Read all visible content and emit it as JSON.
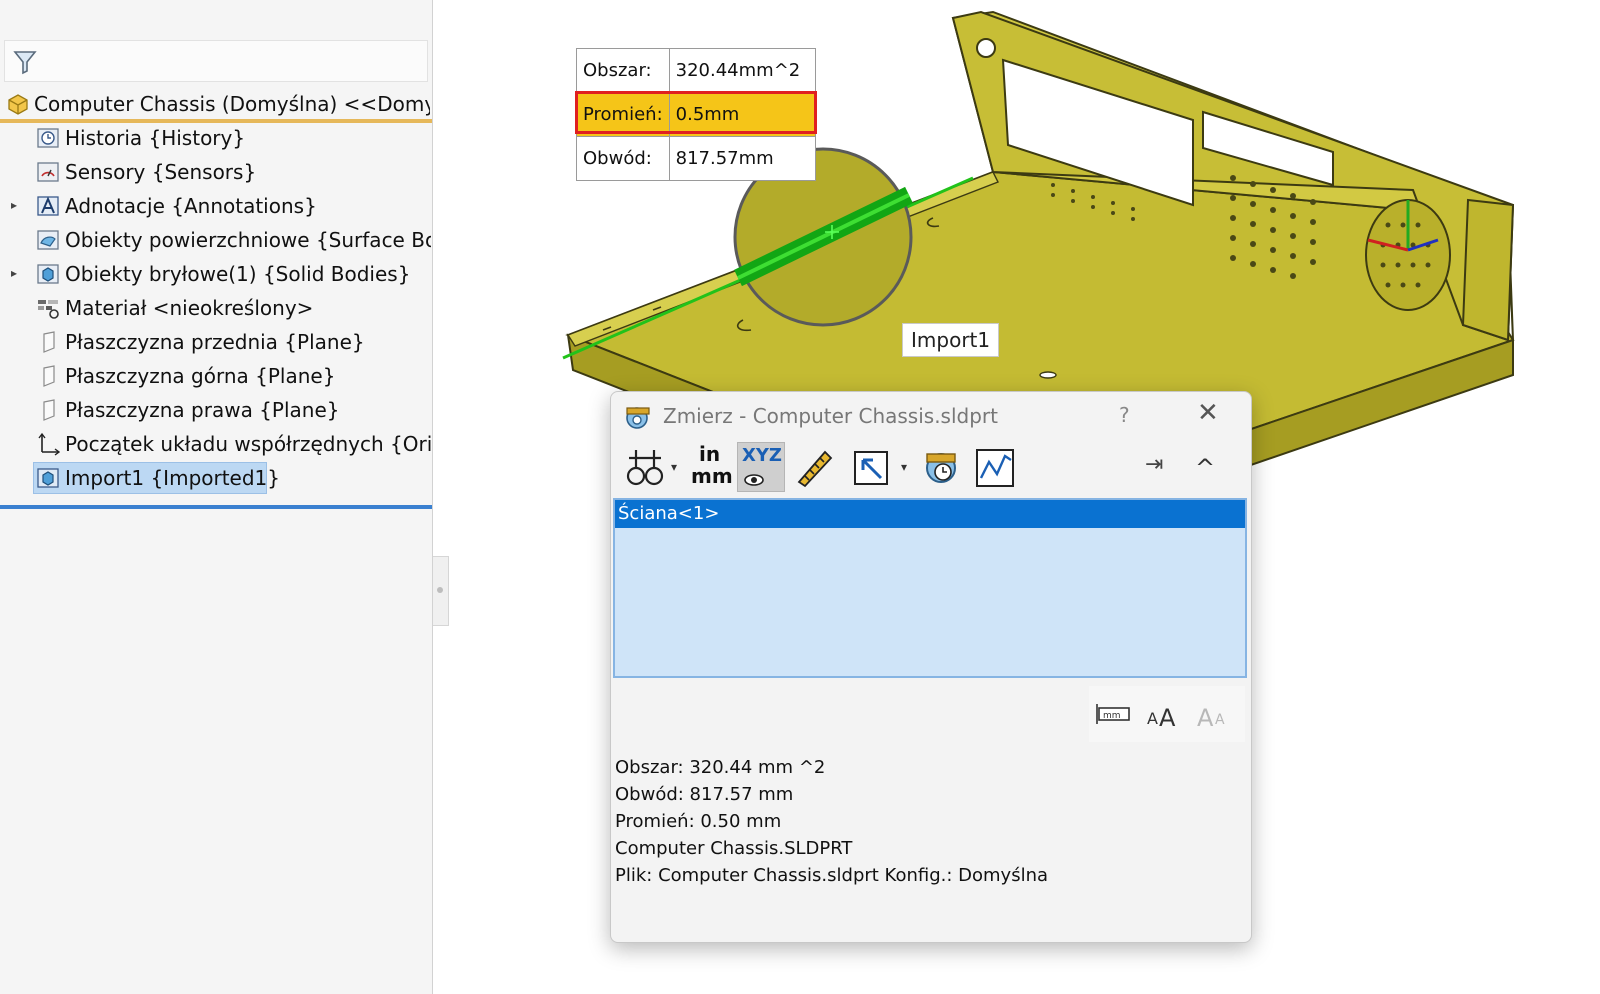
{
  "tree": {
    "root_label": "Computer Chassis (Domyślna) <<Domyśl",
    "items": [
      {
        "label": "Historia {History}",
        "icon": "history-icon",
        "expandable": false
      },
      {
        "label": "Sensory {Sensors}",
        "icon": "sensor-icon",
        "expandable": false
      },
      {
        "label": "Adnotacje {Annotations}",
        "icon": "annotation-icon",
        "expandable": true
      },
      {
        "label": "Obiekty powierzchniowe {Surface Bod",
        "icon": "surface-bodies-icon",
        "expandable": false
      },
      {
        "label": "Obiekty bryłowe(1) {Solid Bodies}",
        "icon": "solid-bodies-icon",
        "expandable": true
      },
      {
        "label": "Materiał <nieokreślony>",
        "icon": "material-icon",
        "expandable": false
      },
      {
        "label": "Płaszczyzna przednia {Plane}",
        "icon": "plane-icon",
        "expandable": false
      },
      {
        "label": "Płaszczyzna górna {Plane}",
        "icon": "plane-icon",
        "expandable": false
      },
      {
        "label": "Płaszczyzna prawa {Plane}",
        "icon": "plane-icon",
        "expandable": false
      },
      {
        "label": "Początek układu współrzędnych {Orig",
        "icon": "origin-icon",
        "expandable": false
      },
      {
        "label": "Import1 {Imported1}",
        "icon": "import-feature-icon",
        "expandable": false,
        "selected": true
      }
    ]
  },
  "callout": {
    "area_key": "Obszar:",
    "area_value": "320.44mm^2",
    "radius_key": "Promień:",
    "radius_value": "0.5mm",
    "perimeter_key": "Obwód:",
    "perimeter_value": "817.57mm"
  },
  "viewport": {
    "feature_tag": "Import1"
  },
  "dialog": {
    "title": "Zmierz - Computer Chassis.sldprt",
    "help": "?",
    "close": "✕",
    "selection_item": "Ściana<1>",
    "results": [
      "Obszar: 320.44 mm ^2",
      "Obwód: 817.57 mm",
      "Promień: 0.50 mm",
      "Computer Chassis.SLDPRT",
      "Plik: Computer Chassis.sldprt Konfig.: Domyślna"
    ],
    "units_label_top": "in",
    "units_label_bottom": "mm",
    "xyz_label": "XYZ",
    "pin": "⇥",
    "collapse": "^"
  },
  "colors": {
    "model_face": "#c9c03a",
    "model_dark": "#8f8a1e",
    "selection_green": "#22c21a",
    "callout_highlight": "#f5c518",
    "list_selection": "#0a72d1"
  }
}
